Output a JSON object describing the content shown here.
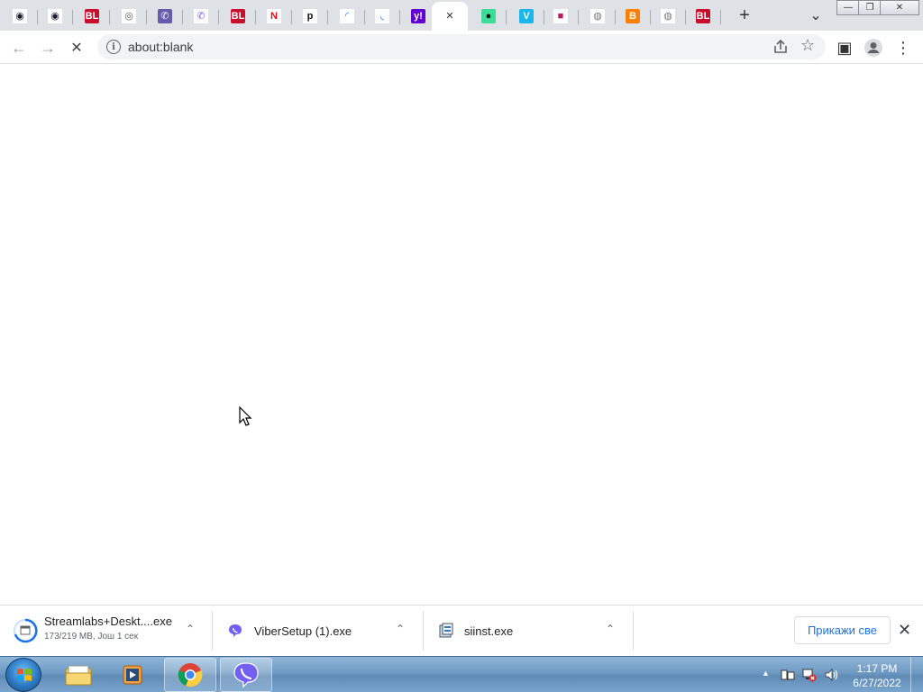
{
  "browser": {
    "tabs": [
      {
        "favicon": "qobuz-icon",
        "glyph": "◉",
        "color": "#1a1a2e",
        "bg": "#fff"
      },
      {
        "favicon": "qobuz-icon",
        "glyph": "◉",
        "color": "#1a1a2e",
        "bg": "#fff"
      },
      {
        "favicon": "blic-icon",
        "glyph": "BL",
        "color": "#fff",
        "bg": "#c8102e"
      },
      {
        "favicon": "chrome-icon",
        "glyph": "◎",
        "color": "#555",
        "bg": "#fff"
      },
      {
        "favicon": "viber-icon",
        "glyph": "✆",
        "color": "#fff",
        "bg": "#665cac"
      },
      {
        "favicon": "viber-outline-icon",
        "glyph": "✆",
        "color": "#7360f2",
        "bg": "#fff"
      },
      {
        "favicon": "blic-icon",
        "glyph": "BL",
        "color": "#fff",
        "bg": "#c8102e"
      },
      {
        "favicon": "netflix-icon",
        "glyph": "N",
        "color": "#e50914",
        "bg": "#fff"
      },
      {
        "favicon": "p-icon",
        "glyph": "p",
        "color": "#111",
        "bg": "#fff"
      },
      {
        "favicon": "loading-icon",
        "glyph": "◜",
        "color": "#1a73e8",
        "bg": "#fff"
      },
      {
        "favicon": "loading-icon",
        "glyph": "◟",
        "color": "#1a73e8",
        "bg": "#fff"
      },
      {
        "favicon": "yahoo-icon",
        "glyph": "y!",
        "color": "#fff",
        "bg": "#6001d2"
      },
      {
        "favicon": "close-icon",
        "glyph": "✕",
        "color": "#333",
        "bg": "#fff"
      },
      {
        "favicon": "app-icon",
        "glyph": "●",
        "color": "#111",
        "bg": "#3ddc97"
      },
      {
        "favicon": "vimeo-icon",
        "glyph": "V",
        "color": "#fff",
        "bg": "#1ab7ea"
      },
      {
        "favicon": "magenta-icon",
        "glyph": "■",
        "color": "#c2185b",
        "bg": "#fff"
      },
      {
        "favicon": "globe-icon",
        "glyph": "◍",
        "color": "#777",
        "bg": "#fff"
      },
      {
        "favicon": "blogger-icon",
        "glyph": "B",
        "color": "#fff",
        "bg": "#ff8000"
      },
      {
        "favicon": "globe-icon",
        "glyph": "◍",
        "color": "#777",
        "bg": "#fff"
      },
      {
        "favicon": "blic-icon",
        "glyph": "BL",
        "color": "#fff",
        "bg": "#c8102e"
      }
    ],
    "new_tab": "+",
    "tab_search": "⌄",
    "window_controls": {
      "minimize": "—",
      "restore": "❐",
      "close": "✕"
    },
    "toolbar": {
      "back": "←",
      "forward": "→",
      "stop": "✕",
      "url": "about:blank",
      "info": "i",
      "star": "☆",
      "side_panel": "▣",
      "menu": "⋮"
    }
  },
  "downloads": {
    "items": [
      {
        "name": "Streamlabs+Deskt....exe",
        "status": "173/219 MB, Још 1 сек",
        "icon": "installer-progress-icon"
      },
      {
        "name": "ViberSetup (1).exe",
        "status": "",
        "icon": "viber-icon"
      },
      {
        "name": "siinst.exe",
        "status": "",
        "icon": "setup-icon"
      }
    ],
    "chevron": "⌃",
    "show_all": "Прикажи све",
    "close": "✕"
  },
  "taskbar": {
    "apps": [
      "explorer-icon",
      "media-player-icon",
      "chrome-icon",
      "viber-icon"
    ],
    "time": "1:17 PM",
    "date": "6/27/2022",
    "tray_arrow": "▲"
  }
}
